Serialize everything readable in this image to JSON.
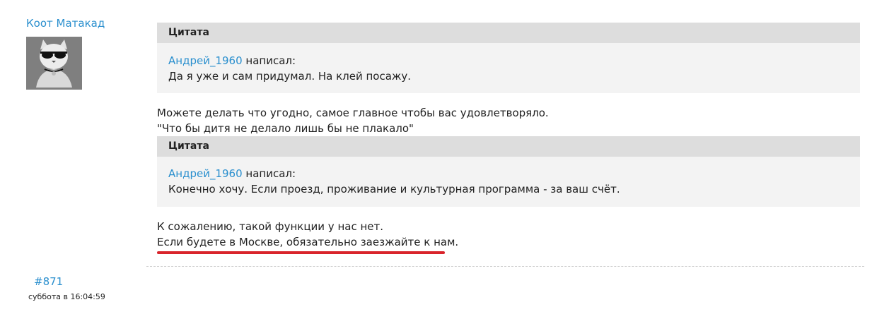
{
  "post": {
    "author": "Коот Матакад",
    "avatar_icon": "cat-with-sunglasses-avatar",
    "number": "#871",
    "timestamp": "суббота в 16:04:59"
  },
  "quotes": [
    {
      "header": "Цитата",
      "author": "Андрей_1960",
      "wrote": " написал:",
      "text": "Да я уже и сам придумал. На клей посажу."
    },
    {
      "header": "Цитата",
      "author": "Андрей_1960",
      "wrote": " написал:",
      "text": "Конечно хочу. Если проезд, проживание и культурная программа - за ваш счёт."
    }
  ],
  "replies": [
    {
      "line1": "Можете делать что угодно, самое главное чтобы вас удовлетворяло.",
      "line2": "\"Что бы дитя не делало лишь бы не плакало\""
    },
    {
      "line1": "К сожалению, такой функции у нас нет.",
      "line2": "Если будете в Москве, обязательно заезжайте к нам."
    }
  ],
  "colors": {
    "link": "#2a8fce",
    "quote_header_bg": "#dddddd",
    "quote_bg": "#f3f3f3",
    "underline": "#d9242b"
  }
}
